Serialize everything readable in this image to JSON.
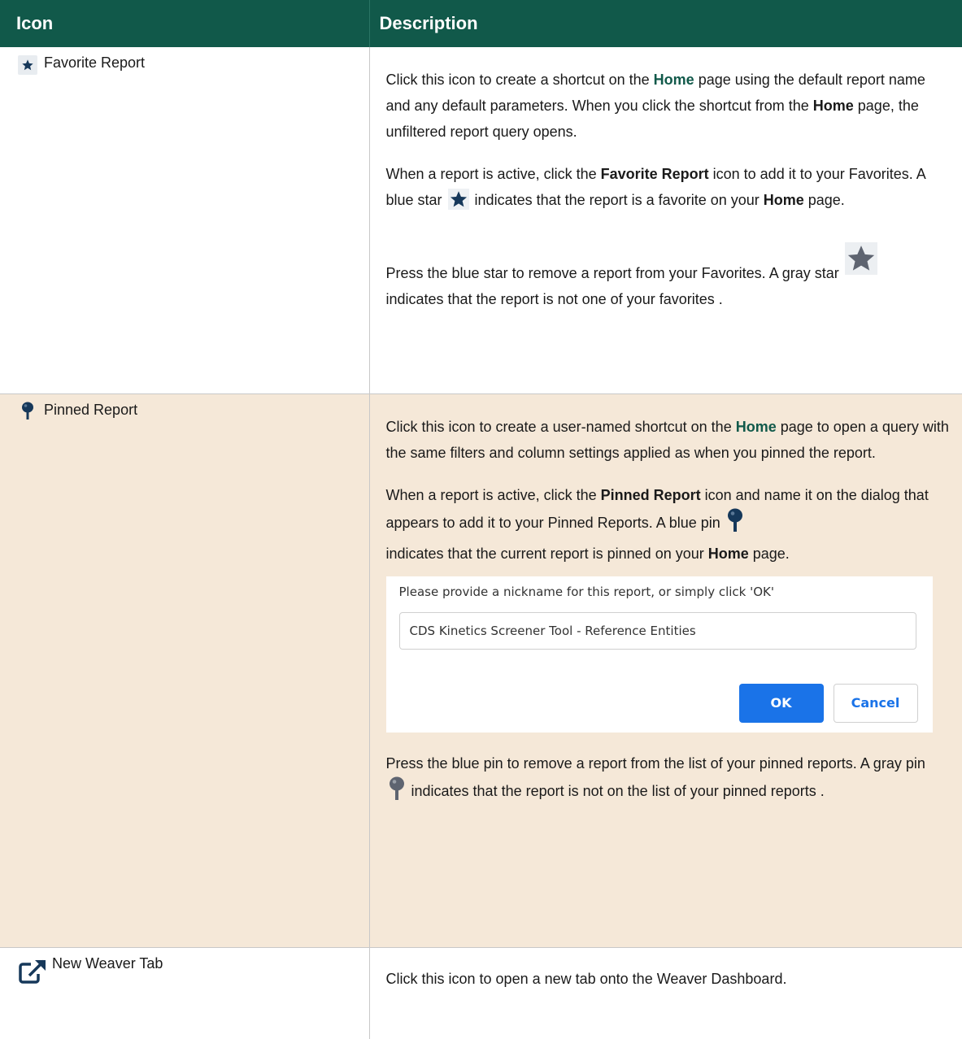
{
  "header": {
    "icon": "Icon",
    "description": "Description"
  },
  "colors": {
    "header_bg": "#11594a",
    "pinned_row_bg": "#f5e8d8",
    "link": "#11594a",
    "icon_blue": "#16385a",
    "icon_gray": "#5e6470",
    "ok_button": "#1a73e8"
  },
  "rows": [
    {
      "icon_name": "star-icon",
      "label": "Favorite Report",
      "p1": {
        "a": "Click this icon to create a shortcut on the ",
        "b": "Home",
        "c": " page using the default report name and any default parameters. When you click the shortcut from the ",
        "d": "Home",
        "e": " page, the unfiltered report query opens."
      },
      "p2": {
        "a": "When a report is active, click the ",
        "b": "Favorite Report",
        "c": " icon to add it to your Favorites. A blue star ",
        "d": " indicates that the report is a favorite on your ",
        "e": "Home",
        "f": " page."
      },
      "p3": {
        "a": "Press the blue star to remove a report from your Favorites. A gray star ",
        "b": "indicates that the report is not one of your favorites ."
      }
    },
    {
      "icon_name": "pin-icon",
      "label": "Pinned Report",
      "p1": {
        "a": "Click this icon to create a user-named shortcut on the ",
        "b": "Home",
        "c": " page to open a query with the same filters and column settings applied as when you pinned the report."
      },
      "p2": {
        "a": "When a report is active, click the ",
        "b": "Pinned Report",
        "c": " icon and name it on the dialog that appears to add it to your Pinned Reports. A blue pin ",
        "d": "indicates that the current report is pinned on your ",
        "e": "Home",
        "f": " page."
      },
      "dialog": {
        "prompt": "Please provide a nickname for this report, or simply click 'OK'",
        "value": "CDS Kinetics Screener Tool - Reference Entities",
        "ok": "OK",
        "cancel": "Cancel"
      },
      "p3": {
        "a": "Press the blue pin to remove a report from the list of your pinned reports. A gray pin ",
        "b": " indicates that the report is not on the list of your pinned reports ."
      }
    },
    {
      "icon_name": "external-link-icon",
      "label": "New Weaver Tab",
      "p1": "Click this icon to open a new tab onto the Weaver Dashboard."
    }
  ]
}
